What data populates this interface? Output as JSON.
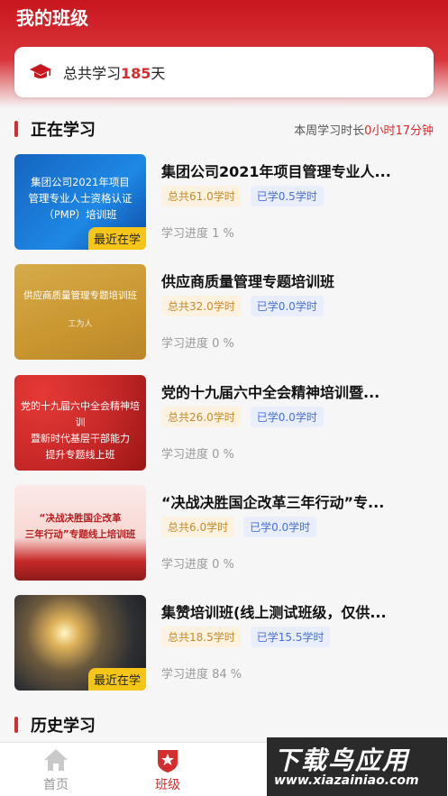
{
  "header": {
    "title": "我的班级"
  },
  "summary": {
    "prefix": "总共学习",
    "days": "185",
    "suffix": "天"
  },
  "current": {
    "title": "正在学习",
    "weekly_prefix": "本周学习时长",
    "weekly_value": "0小时17分钟"
  },
  "courses": [
    {
      "title": "集团公司2021年项目管理专业人...",
      "total": "总共61.0学时",
      "done": "已学0.5学时",
      "progress": "学习进度 1 %",
      "badge": "最近在学",
      "thumb_lines": [
        "集团公司2021年项目",
        "管理专业人士资格认证",
        "（PMP）培训班"
      ]
    },
    {
      "title": "供应商质量管理专题培训班",
      "total": "总共32.0学时",
      "done": "已学0.0学时",
      "progress": "学习进度 0 %",
      "badge": "",
      "thumb_lines": [
        "供应商质量管理专题培训班",
        "工为人"
      ]
    },
    {
      "title": "党的十九届六中全会精神培训暨...",
      "total": "总共26.0学时",
      "done": "已学0.0学时",
      "progress": "学习进度 0 %",
      "badge": "",
      "thumb_lines": [
        "党的十九届六中全会精神培训",
        "暨新时代基层干部能力",
        "提升专题线上班"
      ]
    },
    {
      "title": "“决战决胜国企改革三年行动”专...",
      "total": "总共6.0学时",
      "done": "已学0.0学时",
      "progress": "学习进度 0 %",
      "badge": "",
      "thumb_lines": [
        "“决战决胜国企改革",
        "三年行动”专题线上培训班"
      ]
    },
    {
      "title": "集赞培训班(线上测试班级，仅供...",
      "total": "总共18.5学时",
      "done": "已学15.5学时",
      "progress": "学习进度 84 %",
      "badge": "最近在学",
      "thumb_lines": []
    }
  ],
  "history": {
    "title": "历史学习"
  },
  "tabbar": {
    "home": "首页",
    "class": "班级"
  },
  "watermark": {
    "main": "下载鸟应用",
    "sub": "www.xiazainiao.com"
  },
  "colors": {
    "brand_red": "#c8161d",
    "accent_red": "#d32f2f",
    "badge_yellow": "#f5c518"
  },
  "icons": [
    "graduation-cap-icon",
    "home-icon",
    "class-shield-icon"
  ]
}
